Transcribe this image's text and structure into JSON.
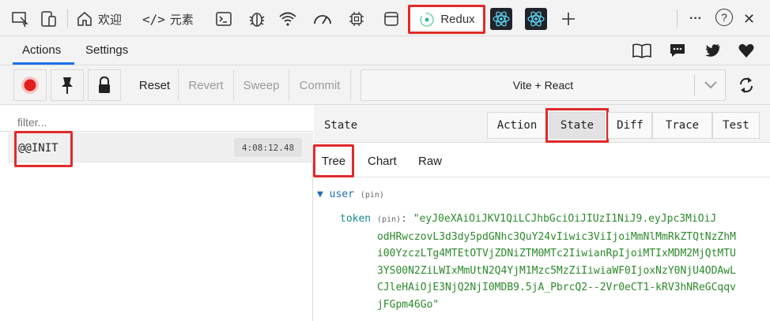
{
  "topbar": {
    "tabs": [
      {
        "label": "欢迎",
        "icon": "home-icon"
      },
      {
        "label": "元素",
        "icon": "code-icon"
      }
    ],
    "redux_tab_label": "Redux",
    "more_label": "···",
    "help_label": "?",
    "close_label": "✕"
  },
  "nav": {
    "actions_label": "Actions",
    "settings_label": "Settings"
  },
  "toolbar": {
    "reset_label": "Reset",
    "revert_label": "Revert",
    "sweep_label": "Sweep",
    "commit_label": "Commit",
    "instance_label": "Vite + React"
  },
  "left": {
    "filter_placeholder": "filter...",
    "actions": [
      {
        "name": "@@INIT",
        "time": "4:08:12.48"
      }
    ]
  },
  "right": {
    "title": "State",
    "modes": [
      "Action",
      "State",
      "Diff",
      "Trace",
      "Test"
    ],
    "active_mode": "State",
    "view_tabs": [
      "Tree",
      "Chart",
      "Raw"
    ],
    "active_view": "Tree",
    "tree": {
      "root_key": "user",
      "pin_label": "(pin)",
      "token_key": "token",
      "token_value_lines": [
        "token (pin): \"eyJ0eXAiOiJKV1QiLCJhbGciOiJIUzI1NiJ9.eyJpc3MiOiJ",
        "              odHRwczovL3d3dy5pdGNhc3QuY24vIiwic3ViIjoiMmNlMmRkZTQtNzZhM",
        "              i00YzczLTg4MTEtOTVjZDNiZTM0MTc2IiwianRpIjoiMTIxMDM2MjQtMTU",
        "              3YS00N2ZiLWIxMmUtN2Q4YjM1Mzc5MzZiIiwiaWF0IjoxNzY0NjU4ODAwL",
        "              CJleHAiOjE3NjQ2NjI0MDB9.5jA_PbrcQ2--2Vr0eCT1-kRV3hNReGCqqv",
        "              jFGpm46Go\""
      ]
    }
  }
}
